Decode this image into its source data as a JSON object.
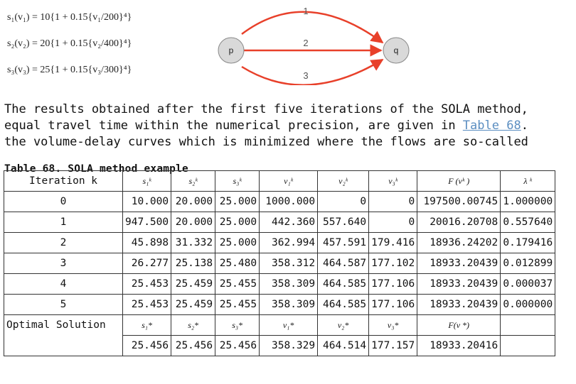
{
  "formulas": [
    "s₁(v₁) = 10{1 + 0.15{v₁/200}⁴}",
    "s₂(v₂) = 20{1 + 0.15{v₂/400}⁴}",
    "s₃(v₃) = 25{1 + 0.15{v₃/300}⁴}"
  ],
  "diagram": {
    "node_p": "p",
    "node_q": "q",
    "edge_1": "1",
    "edge_2": "2",
    "edge_3": "3",
    "colors": {
      "edge": "#e8402a",
      "node_fill": "#d9d9d9",
      "node_stroke": "#888888"
    }
  },
  "paragraph": {
    "line1": "The results obtained after the first five iterations of the SOLA method, ",
    "line2a": "equal travel time within the numerical precision, are given in ",
    "link": "Table 68",
    "line2b": ". ",
    "line3": "the volume-delay curves which is minimized where the flows are so-called"
  },
  "caption": "Table 68. SOLA method example",
  "table": {
    "headers": [
      "Iteration k",
      "s₁ᵏ",
      "s₂ᵏ",
      "s₃ᵏ",
      "v₁ᵏ",
      "v₂ᵏ",
      "v₃ᵏ",
      "F (vᵏ )",
      "λ ᵏ"
    ],
    "rows": [
      [
        "0",
        "10.000",
        "20.000",
        "25.000",
        "1000.000",
        "0",
        "0",
        "197500.00745",
        "1.000000"
      ],
      [
        "1",
        "947.500",
        "20.000",
        "25.000",
        "442.360",
        "557.640",
        "0",
        "20016.20708",
        "0.557640"
      ],
      [
        "2",
        "45.898",
        "31.332",
        "25.000",
        "362.994",
        "457.591",
        "179.416",
        "18936.24202",
        "0.179416"
      ],
      [
        "3",
        "26.277",
        "25.138",
        "25.480",
        "358.312",
        "464.587",
        "177.102",
        "18933.20439",
        "0.012899"
      ],
      [
        "4",
        "25.453",
        "25.459",
        "25.455",
        "358.309",
        "464.585",
        "177.106",
        "18933.20439",
        "0.000037"
      ],
      [
        "5",
        "25.453",
        "25.459",
        "25.455",
        "358.309",
        "464.585",
        "177.106",
        "18933.20439",
        "0.000000"
      ]
    ],
    "optimal_label": "Optimal Solution",
    "optimal_headers": [
      "s₁*",
      "s₂*",
      "s₃*",
      "v₁*",
      "v₂*",
      "v₃*",
      "F(v *)",
      ""
    ],
    "optimal_row": [
      "25.456",
      "25.456",
      "25.456",
      "358.329",
      "464.514",
      "177.157",
      "18933.20416",
      ""
    ]
  }
}
